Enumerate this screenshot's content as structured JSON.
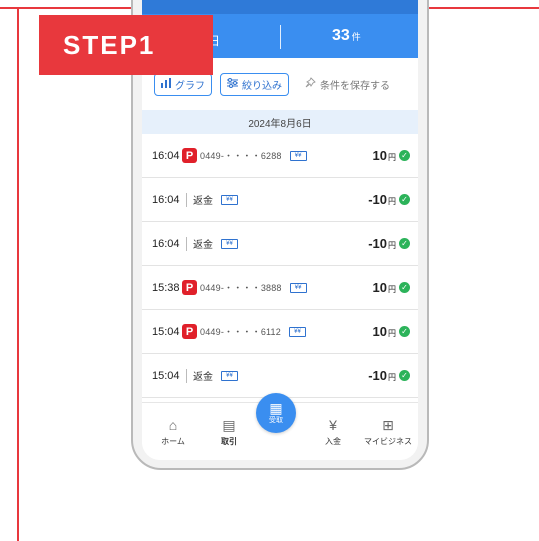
{
  "step_label": "STEP1",
  "header": {
    "left_text": "日",
    "count": "33",
    "count_unit": "件"
  },
  "toolbar": {
    "graph_label": "グラフ",
    "filter_label": "絞り込み",
    "save_label": "条件を保存する"
  },
  "date_header": "2024年8月6日",
  "transactions": [
    {
      "time": "16:04",
      "kind": "paypay",
      "phone": "0449-・・・・6288",
      "refund_label": "",
      "amount": "10",
      "unit": "円"
    },
    {
      "time": "16:04",
      "kind": "refund",
      "phone": "",
      "refund_label": "返金",
      "amount": "-10",
      "unit": "円"
    },
    {
      "time": "16:04",
      "kind": "refund",
      "phone": "",
      "refund_label": "返金",
      "amount": "-10",
      "unit": "円"
    },
    {
      "time": "15:38",
      "kind": "paypay",
      "phone": "0449-・・・・3888",
      "refund_label": "",
      "amount": "10",
      "unit": "円"
    },
    {
      "time": "15:04",
      "kind": "paypay",
      "phone": "0449-・・・・6112",
      "refund_label": "",
      "amount": "10",
      "unit": "円"
    },
    {
      "time": "15:04",
      "kind": "refund",
      "phone": "",
      "refund_label": "返金",
      "amount": "-10",
      "unit": "円"
    }
  ],
  "ticket_glyph": "¥¥",
  "tabs": [
    {
      "label": "ホーム",
      "icon": "home-icon",
      "glyph": "⌂"
    },
    {
      "label": "取引",
      "icon": "receipt-icon",
      "glyph": "▤"
    },
    {
      "label": "受取",
      "icon": "qr-icon",
      "glyph": "▦"
    },
    {
      "label": "入金",
      "icon": "yen-icon",
      "glyph": "¥"
    },
    {
      "label": "マイビジネス",
      "icon": "grid-icon",
      "glyph": "⊞"
    }
  ],
  "colors": {
    "accent_red": "#e8383d",
    "accent_blue": "#3a8ef0",
    "success_green": "#2cb35a"
  }
}
